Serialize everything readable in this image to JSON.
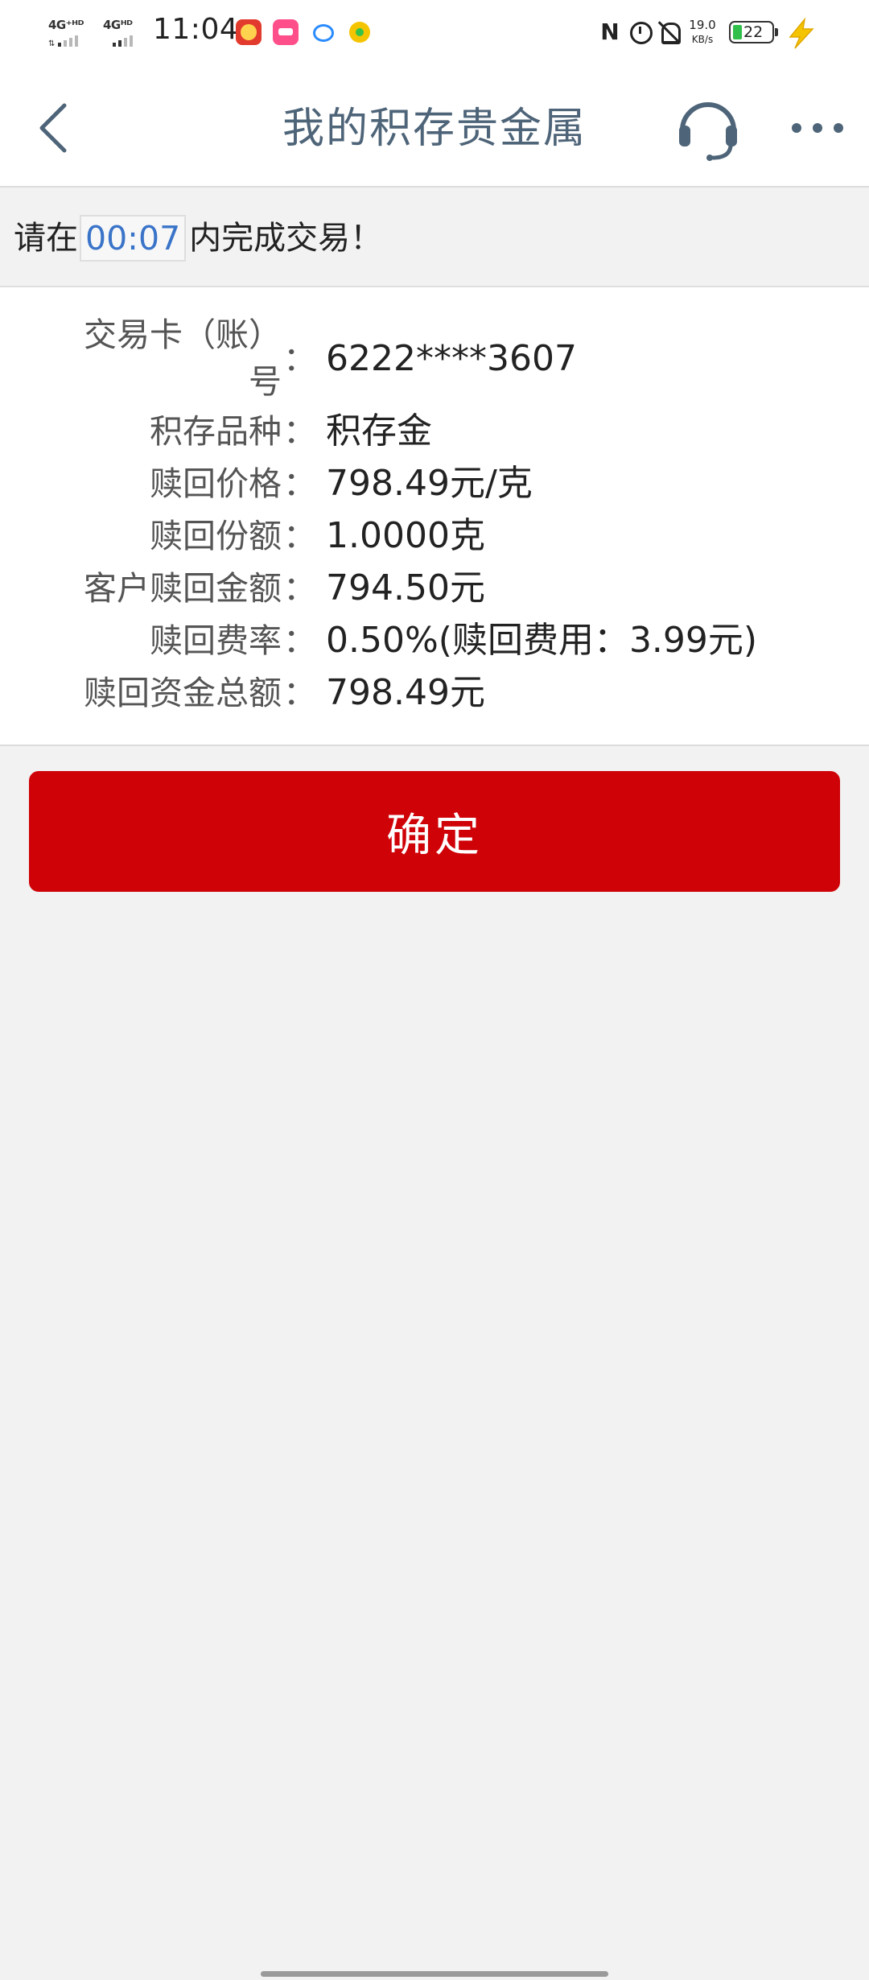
{
  "status_bar": {
    "sim1_network": "4G⁺ᴴᴰ",
    "sim2_network": "4Gᴴᴰ",
    "time": "11:04",
    "net_speed_value": "19.0",
    "net_speed_unit": "KB/s",
    "battery_level": "22",
    "battery_fraction": 0.22,
    "app_icons": [
      "game-app-icon",
      "lala-app-icon",
      "chat-bubble-icon",
      "qq-music-icon"
    ],
    "right_icons": [
      "nfc-icon",
      "alarm-icon",
      "mute-icon",
      "charging-icon"
    ],
    "colors": {
      "battery_fill": "#2fbf4a",
      "charge_bolt": "#f5c400"
    }
  },
  "nav": {
    "title": "我的积存贵金属",
    "icons": [
      "back-arrow-icon",
      "customer-service-headset-icon",
      "more-dots-icon"
    ],
    "title_color": "#4e6478"
  },
  "countdown": {
    "prefix": "请在",
    "timer": "00:07",
    "suffix": "内完成交易！",
    "timer_color": "#3a74c9"
  },
  "details": {
    "card_label_line1": "交易卡（账）",
    "card_label_line2": "号",
    "card_value": "6222****3607",
    "variety_label": "积存品种",
    "variety_value": "积存金",
    "price_label": "赎回价格",
    "price_value": "798.49元/克",
    "quantity_label": "赎回份额",
    "quantity_value": "1.0000克",
    "customer_amount_label": "客户赎回金额",
    "customer_amount_value": "794.50元",
    "fee_rate_label": "赎回费率",
    "fee_rate_value": "0.50%(赎回费用：3.99元)",
    "total_label": "赎回资金总额",
    "total_value": "798.49元",
    "colon": "："
  },
  "actions": {
    "confirm_label": "确定",
    "confirm_color": "#cf0207"
  }
}
